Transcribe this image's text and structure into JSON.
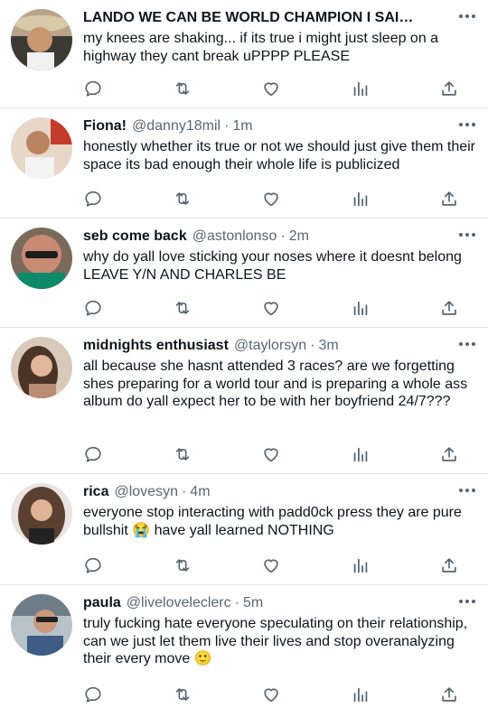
{
  "feed": {
    "tweets": [
      {
        "name": "LANDO WE CAN BE WORLD CHAMPION I SAID ...",
        "handle": "",
        "time": "",
        "text": "my knees are shaking... if its true i might just sleep on a highway they cant break uPPPP PLEASE"
      },
      {
        "name": "Fiona!",
        "handle": "@danny18mil",
        "time": "1m",
        "text": "honestly whether its true or not we should just give them their space its bad enough their whole life is publicized"
      },
      {
        "name": "seb come back",
        "handle": "@astonlonso",
        "time": "2m",
        "text": "why do yall love sticking your noses where it doesnt belong LEAVE Y/N AND CHARLES BE"
      },
      {
        "name": "midnights enthusiast",
        "handle": "@taylorsyn",
        "time": "3m",
        "text": "all because she hasnt attended 3 races? are we forgetting shes preparing for a world tour and is preparing a whole ass album do yall expect her to be with her boyfriend 24/7???"
      },
      {
        "name": "rica",
        "handle": "@lovesyn",
        "time": "4m",
        "text": "everyone stop interacting with padd0ck press they are pure bullshit 😭 have yall learned NOTHING"
      },
      {
        "name": "paula",
        "handle": "@liveloveleclerc",
        "time": "5m",
        "text": "truly fucking hate everyone speculating on their relationship, can we just let them live their lives and stop overanalyzing their every move 🙂"
      }
    ],
    "separator": "·"
  },
  "icons": [
    "reply-icon",
    "retweet-icon",
    "like-icon",
    "analytics-icon",
    "share-icon",
    "more-options-icon"
  ],
  "colors": {
    "icon": "#536471",
    "text": "#0f1419",
    "secondary": "#5b6670",
    "divider": "#e6e6e6"
  }
}
